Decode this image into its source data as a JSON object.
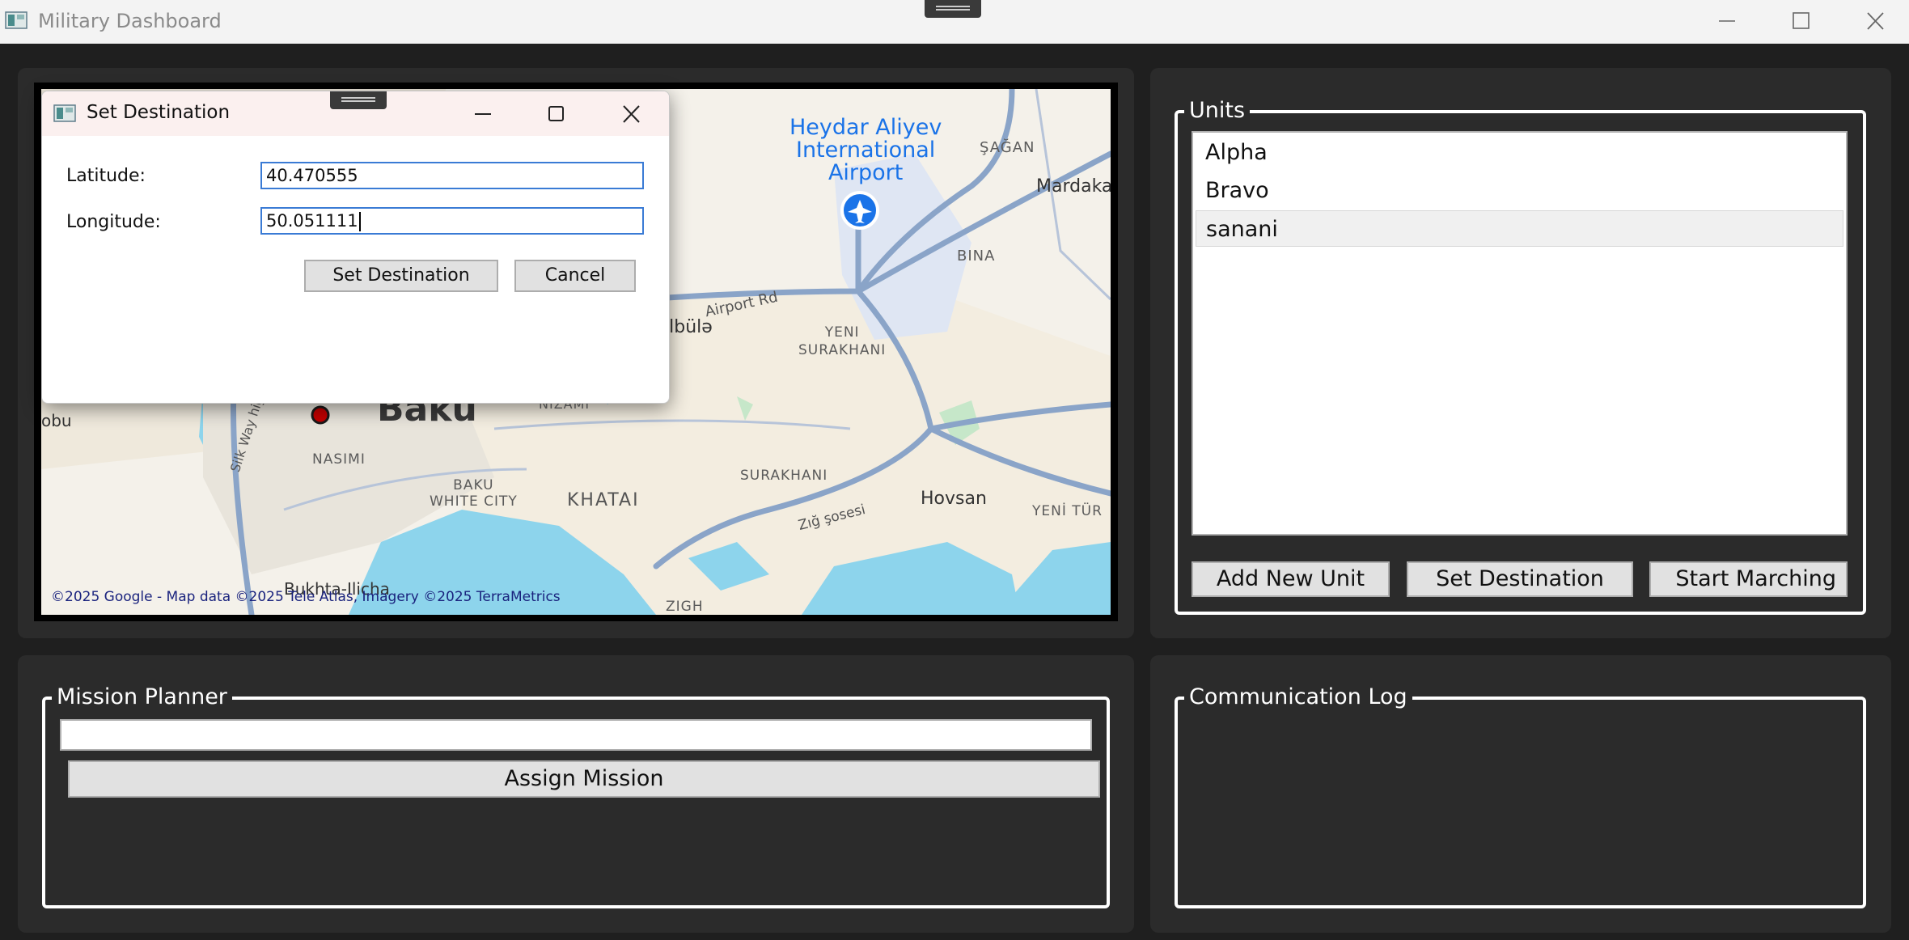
{
  "window": {
    "title": "Military Dashboard",
    "icons": {
      "app": "app-icon",
      "minimize": "minimize-icon",
      "maximize": "maximize-icon",
      "close": "close-icon"
    }
  },
  "map": {
    "copyright": "©2025 Google - Map data ©2025 Tele Atlas, Imagery ©2025 TerraMetrics",
    "labels": {
      "airport_line1": "Heydar Aliyev",
      "airport_line2": "International",
      "airport_line3": "Airport",
      "sagan": "ŞAĞAN",
      "mardakan": "Mardaka",
      "bina": "BINA",
      "airport_rd": "Airport Rd",
      "zabrat": "ilbülə",
      "yeni_surakhani_1": "YENI",
      "yeni_surakhani_2": "SURAKHANI",
      "nizami": "NIZAMI",
      "baku": "Baku",
      "obu": "obu",
      "silk_way": "Silk Way highway",
      "nasimi": "NASIMI",
      "baku_white_city_1": "BAKU",
      "baku_white_city_2": "WHITE CITY",
      "khatai": "KHATAI",
      "surakhani": "SURAKHANI",
      "zig_sosesi": "Zığ şosesi",
      "hovsan": "Hovsan",
      "yeni_tur": "YENİ TÜR",
      "bukhta": "Bukhta-Ilicha",
      "zigh": "ZIGH"
    },
    "colors": {
      "land": "#f4f1ea",
      "water": "#8dd4ec",
      "road": "#8aa4c8",
      "green": "#c6e7c9"
    }
  },
  "units_panel": {
    "legend": "Units",
    "items": [
      "Alpha",
      "Bravo",
      "sanani"
    ],
    "selected_index": 2,
    "add_button": "Add New Unit",
    "destination_button": "Set Destination",
    "march_button": "Start Marching"
  },
  "mission_panel": {
    "legend": "Mission Planner",
    "input_value": "",
    "assign_button": "Assign Mission"
  },
  "comm_panel": {
    "legend": "Communication Log"
  },
  "dialog": {
    "title": "Set Destination",
    "latitude_label": "Latitude:",
    "latitude_value": "40.470555",
    "longitude_label": "Longitude:",
    "longitude_value": "50.051111",
    "set_button": "Set Destination",
    "cancel_button": "Cancel"
  }
}
